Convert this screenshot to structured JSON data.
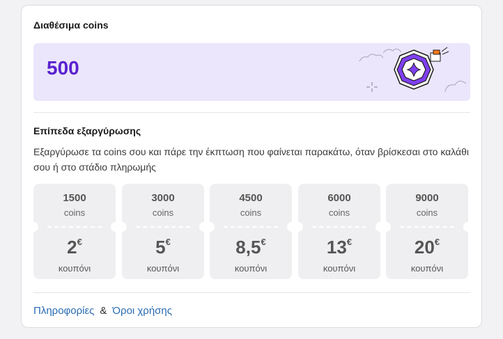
{
  "available": {
    "title": "Διαθέσιμα coins",
    "balance": "500"
  },
  "redeem": {
    "title": "Επίπεδα εξαργύρωσης",
    "description": "Εξαργύρωσε τα coins σου και πάρε την έκπτωση που φαίνεται παρακάτω, όταν βρίσκεσαι στο καλάθι σου ή στο στάδιο πληρωμής",
    "tiers": [
      {
        "coins": "1500",
        "unit": "coins",
        "amount": "2",
        "currency": "€",
        "label": "κουπόνι"
      },
      {
        "coins": "3000",
        "unit": "coins",
        "amount": "5",
        "currency": "€",
        "label": "κουπόνι"
      },
      {
        "coins": "4500",
        "unit": "coins",
        "amount": "8,5",
        "currency": "€",
        "label": "κουπόνι"
      },
      {
        "coins": "6000",
        "unit": "coins",
        "amount": "13",
        "currency": "€",
        "label": "κουπόνι"
      },
      {
        "coins": "9000",
        "unit": "coins",
        "amount": "20",
        "currency": "€",
        "label": "κουπόνι"
      }
    ]
  },
  "footer": {
    "info_link": "Πληροφορίες",
    "separator": "&",
    "terms_link": "Όροι χρήσης"
  },
  "colors": {
    "accent": "#5b21d0",
    "balance_bg": "#ebe6fb",
    "link": "#2a6bb3"
  },
  "icons": [
    "coin-badge-icon",
    "sparkle-icon",
    "gift-box-icon",
    "cloud-icon"
  ]
}
